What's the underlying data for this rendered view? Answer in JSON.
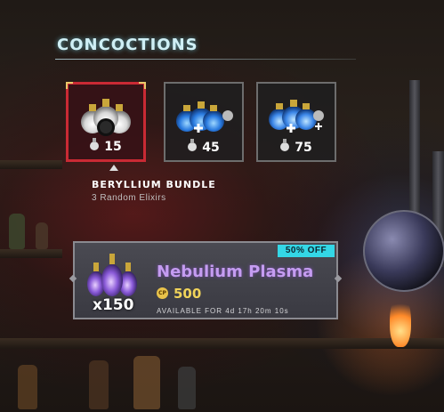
{
  "section": {
    "title": "CONCOCTIONS"
  },
  "bundles": [
    {
      "cost": "15",
      "selected": true
    },
    {
      "cost": "45",
      "selected": false
    },
    {
      "cost": "75",
      "selected": false
    }
  ],
  "selected_bundle": {
    "name": "BERYLLIUM BUNDLE",
    "description": "3 Random Elixirs"
  },
  "featured": {
    "badge": "50% OFF",
    "quantity": "x150",
    "name": "Nebulium Plasma",
    "currency_icon_label": "CP",
    "price": "500",
    "availability": "AVAILABLE FOR 4d 17h 20m 10s"
  },
  "colors": {
    "accent_title": "#cfeff5",
    "selected_border": "#c92a34",
    "badge": "#34d7e6",
    "featured_name": "#c59cf1",
    "price": "#f0d35a"
  },
  "icons": {
    "currency": "elixir-bottle-icon",
    "plus": "plus-icon",
    "premium_currency": "cp-coin-icon"
  }
}
